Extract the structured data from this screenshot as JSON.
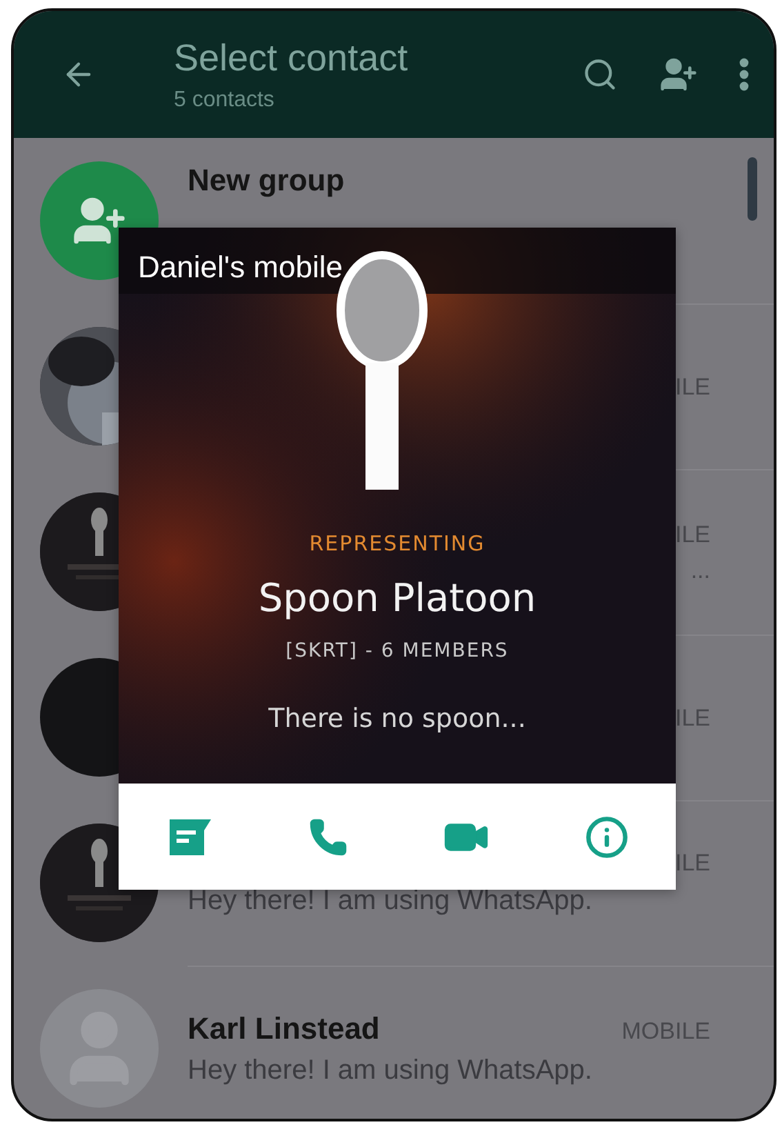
{
  "header": {
    "title": "Select contact",
    "subtitle": "5 contacts"
  },
  "new_group": {
    "label": "New group"
  },
  "contacts": [
    {
      "type": "ILE"
    },
    {
      "type": "ILE",
      "more": "..."
    },
    {
      "kind": "dark",
      "type": "ILE"
    },
    {
      "type": "ILE",
      "status": "Hey there! I am using WhatsApp."
    },
    {
      "kind": "placeholder",
      "name": "Karl Linstead",
      "type": "MOBILE",
      "status": "Hey there! I am using WhatsApp."
    }
  ],
  "popup": {
    "contact_name": "Daniel's mobile",
    "representing": "REPRESENTING",
    "team": "Spoon Platoon",
    "tag": "[SKRT] - 6 MEMBERS",
    "motto": "There is no spoon..."
  }
}
